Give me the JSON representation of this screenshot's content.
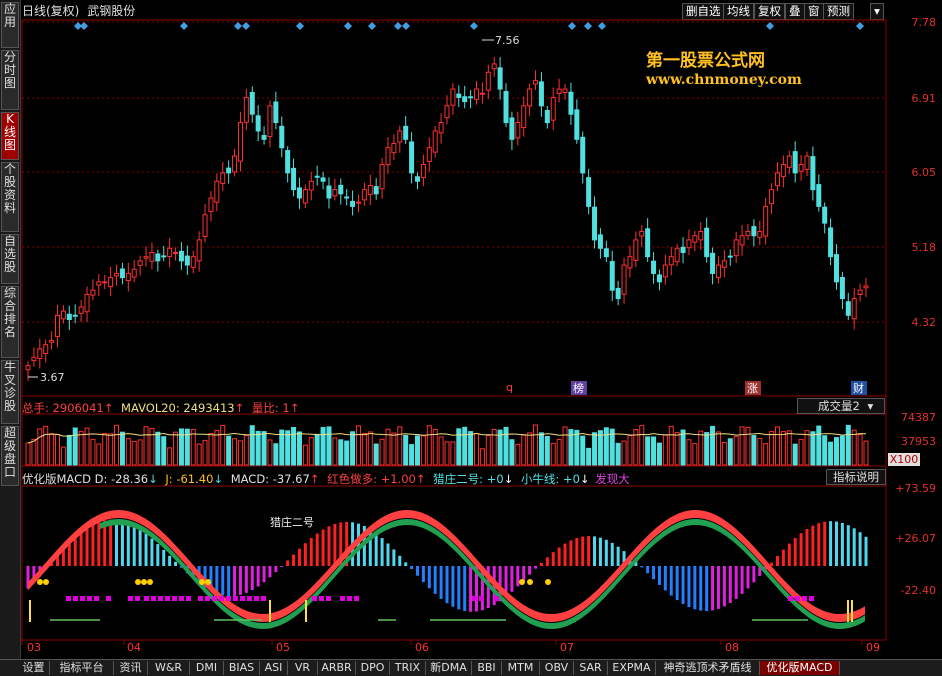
{
  "sidebar": {
    "tabs": [
      {
        "label": "应用",
        "active": false
      },
      {
        "label": "分时图",
        "active": false
      },
      {
        "label": "K线图",
        "active": true
      },
      {
        "label": "个股资料",
        "active": false
      },
      {
        "label": "自选股",
        "active": false
      },
      {
        "label": "综合排名",
        "active": false
      },
      {
        "label": "牛叉诊股",
        "active": false
      },
      {
        "label": "超级盘口",
        "active": false
      }
    ]
  },
  "header": {
    "chart_type": "日线(复权)",
    "stock_name": "武钢股份",
    "buttons": [
      "删自选",
      "均线",
      "复权",
      "叠",
      "窗",
      "预测"
    ],
    "dropdown_icon": "chevron-down-icon"
  },
  "watermark": {
    "line1": "第一股票公式网",
    "line2": "www.chnmoney.com"
  },
  "price_axis": {
    "labels": [
      "7.78",
      "6.91",
      "6.05",
      "5.18",
      "4.32"
    ]
  },
  "price_annotations": {
    "high": "7.56",
    "low": "3.67"
  },
  "event_markers": [
    "q",
    "榜",
    "涨",
    "财"
  ],
  "volume_panel": {
    "total": "总手: 2906041",
    "mavol": "MAVOL20: 2493413",
    "ratio": "量比: 1",
    "selector": "成交量2",
    "axis": [
      "74387",
      "37953",
      "X100"
    ]
  },
  "macd_panel": {
    "name": "优化版MACD",
    "d": "D: -28.36",
    "j": "J: -61.40",
    "macd": "MACD: -37.67",
    "red_bull": "红色做多: +1.00",
    "zhuang": "猎庄二号: +0",
    "niu": "小牛线: +0",
    "discover": "发现大",
    "note": "猎庄二号",
    "explain_button": "指标说明",
    "axis": [
      "+73.59",
      "+26.07",
      "-22.40"
    ]
  },
  "time_axis": {
    "labels": [
      "03",
      "04",
      "05",
      "06",
      "07",
      "08",
      "09"
    ]
  },
  "bottom_tabs": [
    "设置",
    "指标平台",
    "资讯",
    "W&R",
    "DMI",
    "BIAS",
    "ASI",
    "VR",
    "ARBR",
    "DPO",
    "TRIX",
    "新DMA",
    "BBI",
    "MTM",
    "OBV",
    "SAR",
    "EXPMA",
    "神奇逃顶术矛盾线",
    "优化版MACD"
  ],
  "active_bottom_tab": "优化版MACD",
  "colors": {
    "up": "#ff3030",
    "down": "#50e0e0",
    "grid": "#8b0000",
    "accent": "#ffc020",
    "purple": "#e000e0"
  },
  "chart_data": {
    "type": "candlestick",
    "price_range": [
      3.67,
      7.56
    ],
    "closes": [
      3.7,
      3.8,
      3.9,
      3.95,
      4.0,
      4.3,
      4.35,
      4.25,
      4.3,
      4.4,
      4.55,
      4.6,
      4.7,
      4.7,
      4.75,
      4.8,
      4.75,
      4.8,
      4.85,
      4.95,
      5.0,
      5.05,
      4.95,
      5.0,
      5.1,
      5.05,
      4.95,
      4.9,
      5.0,
      5.2,
      5.5,
      5.7,
      5.9,
      6.0,
      6.0,
      6.2,
      6.6,
      6.9,
      6.7,
      6.5,
      6.4,
      6.8,
      6.6,
      6.3,
      6.0,
      5.8,
      5.7,
      5.8,
      5.9,
      5.95,
      5.9,
      5.7,
      5.8,
      5.75,
      5.7,
      5.6,
      5.65,
      5.8,
      5.85,
      5.75,
      6.1,
      6.3,
      6.35,
      6.5,
      6.4,
      6.0,
      5.9,
      6.1,
      6.3,
      6.5,
      6.6,
      6.8,
      7.0,
      6.9,
      6.85,
      6.9,
      7.0,
      6.95,
      7.2,
      7.3,
      7.0,
      6.6,
      6.4,
      6.6,
      6.8,
      7.0,
      7.1,
      6.8,
      6.6,
      6.9,
      7.0,
      7.0,
      6.7,
      6.4,
      6.0,
      5.6,
      5.2,
      5.1,
      5.0,
      4.6,
      4.5,
      4.9,
      5.0,
      5.2,
      5.3,
      5.0,
      4.8,
      4.7,
      4.9,
      5.0,
      5.1,
      5.05,
      5.2,
      5.25,
      5.3,
      5.0,
      4.8,
      4.9,
      4.95,
      5.0,
      5.2,
      5.25,
      5.3,
      5.25,
      5.3,
      5.6,
      5.8,
      6.0,
      6.1,
      6.2,
      6.0,
      6.1,
      6.2,
      5.8,
      5.6,
      5.4,
      5.0,
      4.7,
      4.5,
      4.3,
      4.5,
      4.6,
      4.65
    ]
  }
}
